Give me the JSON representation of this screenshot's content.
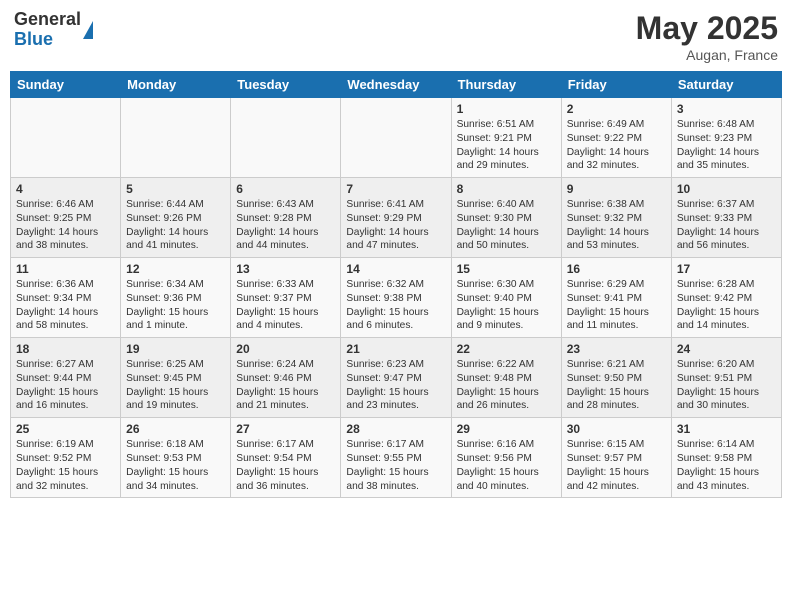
{
  "header": {
    "logo_general": "General",
    "logo_blue": "Blue",
    "month_title": "May 2025",
    "location": "Augan, France"
  },
  "days_of_week": [
    "Sunday",
    "Monday",
    "Tuesday",
    "Wednesday",
    "Thursday",
    "Friday",
    "Saturday"
  ],
  "weeks": [
    [
      {
        "day": "",
        "content": ""
      },
      {
        "day": "",
        "content": ""
      },
      {
        "day": "",
        "content": ""
      },
      {
        "day": "",
        "content": ""
      },
      {
        "day": "1",
        "content": "Sunrise: 6:51 AM\nSunset: 9:21 PM\nDaylight: 14 hours\nand 29 minutes."
      },
      {
        "day": "2",
        "content": "Sunrise: 6:49 AM\nSunset: 9:22 PM\nDaylight: 14 hours\nand 32 minutes."
      },
      {
        "day": "3",
        "content": "Sunrise: 6:48 AM\nSunset: 9:23 PM\nDaylight: 14 hours\nand 35 minutes."
      }
    ],
    [
      {
        "day": "4",
        "content": "Sunrise: 6:46 AM\nSunset: 9:25 PM\nDaylight: 14 hours\nand 38 minutes."
      },
      {
        "day": "5",
        "content": "Sunrise: 6:44 AM\nSunset: 9:26 PM\nDaylight: 14 hours\nand 41 minutes."
      },
      {
        "day": "6",
        "content": "Sunrise: 6:43 AM\nSunset: 9:28 PM\nDaylight: 14 hours\nand 44 minutes."
      },
      {
        "day": "7",
        "content": "Sunrise: 6:41 AM\nSunset: 9:29 PM\nDaylight: 14 hours\nand 47 minutes."
      },
      {
        "day": "8",
        "content": "Sunrise: 6:40 AM\nSunset: 9:30 PM\nDaylight: 14 hours\nand 50 minutes."
      },
      {
        "day": "9",
        "content": "Sunrise: 6:38 AM\nSunset: 9:32 PM\nDaylight: 14 hours\nand 53 minutes."
      },
      {
        "day": "10",
        "content": "Sunrise: 6:37 AM\nSunset: 9:33 PM\nDaylight: 14 hours\nand 56 minutes."
      }
    ],
    [
      {
        "day": "11",
        "content": "Sunrise: 6:36 AM\nSunset: 9:34 PM\nDaylight: 14 hours\nand 58 minutes."
      },
      {
        "day": "12",
        "content": "Sunrise: 6:34 AM\nSunset: 9:36 PM\nDaylight: 15 hours\nand 1 minute."
      },
      {
        "day": "13",
        "content": "Sunrise: 6:33 AM\nSunset: 9:37 PM\nDaylight: 15 hours\nand 4 minutes."
      },
      {
        "day": "14",
        "content": "Sunrise: 6:32 AM\nSunset: 9:38 PM\nDaylight: 15 hours\nand 6 minutes."
      },
      {
        "day": "15",
        "content": "Sunrise: 6:30 AM\nSunset: 9:40 PM\nDaylight: 15 hours\nand 9 minutes."
      },
      {
        "day": "16",
        "content": "Sunrise: 6:29 AM\nSunset: 9:41 PM\nDaylight: 15 hours\nand 11 minutes."
      },
      {
        "day": "17",
        "content": "Sunrise: 6:28 AM\nSunset: 9:42 PM\nDaylight: 15 hours\nand 14 minutes."
      }
    ],
    [
      {
        "day": "18",
        "content": "Sunrise: 6:27 AM\nSunset: 9:44 PM\nDaylight: 15 hours\nand 16 minutes."
      },
      {
        "day": "19",
        "content": "Sunrise: 6:25 AM\nSunset: 9:45 PM\nDaylight: 15 hours\nand 19 minutes."
      },
      {
        "day": "20",
        "content": "Sunrise: 6:24 AM\nSunset: 9:46 PM\nDaylight: 15 hours\nand 21 minutes."
      },
      {
        "day": "21",
        "content": "Sunrise: 6:23 AM\nSunset: 9:47 PM\nDaylight: 15 hours\nand 23 minutes."
      },
      {
        "day": "22",
        "content": "Sunrise: 6:22 AM\nSunset: 9:48 PM\nDaylight: 15 hours\nand 26 minutes."
      },
      {
        "day": "23",
        "content": "Sunrise: 6:21 AM\nSunset: 9:50 PM\nDaylight: 15 hours\nand 28 minutes."
      },
      {
        "day": "24",
        "content": "Sunrise: 6:20 AM\nSunset: 9:51 PM\nDaylight: 15 hours\nand 30 minutes."
      }
    ],
    [
      {
        "day": "25",
        "content": "Sunrise: 6:19 AM\nSunset: 9:52 PM\nDaylight: 15 hours\nand 32 minutes."
      },
      {
        "day": "26",
        "content": "Sunrise: 6:18 AM\nSunset: 9:53 PM\nDaylight: 15 hours\nand 34 minutes."
      },
      {
        "day": "27",
        "content": "Sunrise: 6:17 AM\nSunset: 9:54 PM\nDaylight: 15 hours\nand 36 minutes."
      },
      {
        "day": "28",
        "content": "Sunrise: 6:17 AM\nSunset: 9:55 PM\nDaylight: 15 hours\nand 38 minutes."
      },
      {
        "day": "29",
        "content": "Sunrise: 6:16 AM\nSunset: 9:56 PM\nDaylight: 15 hours\nand 40 minutes."
      },
      {
        "day": "30",
        "content": "Sunrise: 6:15 AM\nSunset: 9:57 PM\nDaylight: 15 hours\nand 42 minutes."
      },
      {
        "day": "31",
        "content": "Sunrise: 6:14 AM\nSunset: 9:58 PM\nDaylight: 15 hours\nand 43 minutes."
      }
    ]
  ]
}
